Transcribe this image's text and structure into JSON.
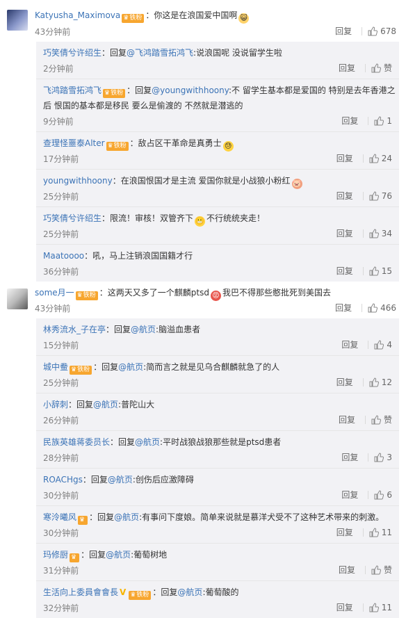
{
  "thread1": {
    "user": "Katyusha_Maximova",
    "badge": "铁粉",
    "text": "：你这是在浪国爱中国啊",
    "time": "43分钟前",
    "reply_label": "回复",
    "likes": "678",
    "replies": [
      {
        "user": "巧笑倩兮许绍生",
        "badge": null,
        "text": "：回复",
        "mention": "@飞鸿踏雪拓鸿飞",
        "text2": ":说浪国呢 没说留学生啦",
        "time": "2分钟前",
        "likes": "赞"
      },
      {
        "user": "飞鸿踏雪拓鸿飞",
        "badge": "铁粉",
        "text": "：回复",
        "mention": "@youngwithhoony",
        "text2": ":不 留学生基本都是爱国的 特别是去年香港之",
        "line2": "后 恨国的基本都是移民 要么是偷渡的 不然就是潜逃的",
        "time": "9分钟前",
        "likes": "1"
      },
      {
        "user": "查理怪噩泰Alter",
        "badge": "铁粉",
        "text": "：敌占区干革命是真勇士",
        "time": "17分钟前",
        "likes": "24"
      },
      {
        "user": "youngwithhoony",
        "badge": null,
        "text": "：在浪国恨国才是主流  爱国你就是小战狼小粉红",
        "time": "25分钟前",
        "likes": "76"
      },
      {
        "user": "巧笑倩兮许绍生",
        "badge": null,
        "text": "：限流！审核！双管齐下",
        "text_after": "不行统统夹走！",
        "time": "25分钟前",
        "likes": "34"
      },
      {
        "user": "Maatoooo",
        "badge": null,
        "text": "：吼，马上注销浪国国籍才行",
        "time": "36分钟前",
        "likes": "15"
      }
    ]
  },
  "thread2": {
    "user": "some月一",
    "badge": "铁粉",
    "text": "：这两天又多了一个麒麟ptsd",
    "text_after": "我巴不得那些憨批死到美国去",
    "time": "43分钟前",
    "reply_label": "回复",
    "likes": "466",
    "replies": [
      {
        "user": "林秀流水_子在亭",
        "badge": null,
        "text": "：回复",
        "mention": "@航页",
        "text2": ":脑溢血患者",
        "time": "15分钟前",
        "likes": "4"
      },
      {
        "user": "城中鲞",
        "badge": "铁粉",
        "text": "：回复",
        "mention": "@航页",
        "text2": ":简而言之就是见乌合麒麟就急了的人",
        "time": "25分钟前",
        "likes": "12"
      },
      {
        "user": "小辞刺",
        "badge": null,
        "text": "：回复",
        "mention": "@航页",
        "text2": ":普陀山大",
        "time": "26分钟前",
        "likes": "赞"
      },
      {
        "user": "民族英雄蒋委员长",
        "badge": null,
        "text": "：回复",
        "mention": "@航页",
        "text2": ":平时战狼战狼那些就是ptsd患者",
        "time": "28分钟前",
        "likes": "3"
      },
      {
        "user": "ROACHgs",
        "badge": null,
        "text": "：回复",
        "mention": "@航页",
        "text2": ":创伤后应激障碍",
        "time": "30分钟前",
        "likes": "6"
      },
      {
        "user": "寒泠曦风",
        "badge": "",
        "text": "：回复",
        "mention": "@航页",
        "text2": ":有事问下度娘。简单来说就是慕洋犬受不了这种艺术带来的刺激。",
        "time": "30分钟前",
        "likes": "11"
      },
      {
        "user": "玛修厨",
        "badge": "",
        "text": "：回复",
        "mention": "@航页",
        "text2": ":葡萄树地",
        "time": "31分钟前",
        "likes": "赞"
      },
      {
        "user": "生活向上委員會會長",
        "badge": "铁粉",
        "vip": "V",
        "text": "：回复",
        "mention": "@航页",
        "text2": ":葡萄酸的",
        "time": "32分钟前",
        "likes": "11"
      }
    ]
  }
}
